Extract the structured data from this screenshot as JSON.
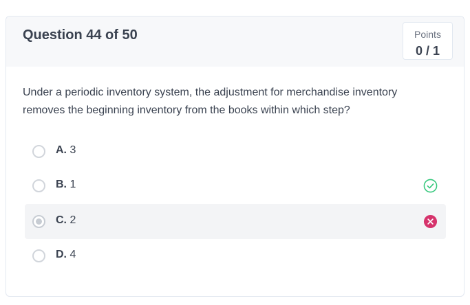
{
  "header": {
    "question_title": "Question 44 of 50",
    "points_label": "Points",
    "points_value": "0 / 1"
  },
  "question": {
    "prompt": "Under a periodic inventory system, the adjustment for merchandise inventory removes the beginning inventory from the books within which step?"
  },
  "choices": [
    {
      "letter": "A.",
      "text": "3",
      "selected": false,
      "status": "none"
    },
    {
      "letter": "B.",
      "text": "1",
      "selected": false,
      "status": "correct",
      "status_icon": "check-circle-icon"
    },
    {
      "letter": "C.",
      "text": "2",
      "selected": true,
      "status": "incorrect",
      "status_icon": "x-circle-icon"
    },
    {
      "letter": "D.",
      "text": "4",
      "selected": false,
      "status": "none"
    }
  ],
  "colors": {
    "correct": "#34c77b",
    "incorrect": "#d6336c",
    "header_bg": "#f7f8fa",
    "selected_bg": "#f3f4f6"
  }
}
